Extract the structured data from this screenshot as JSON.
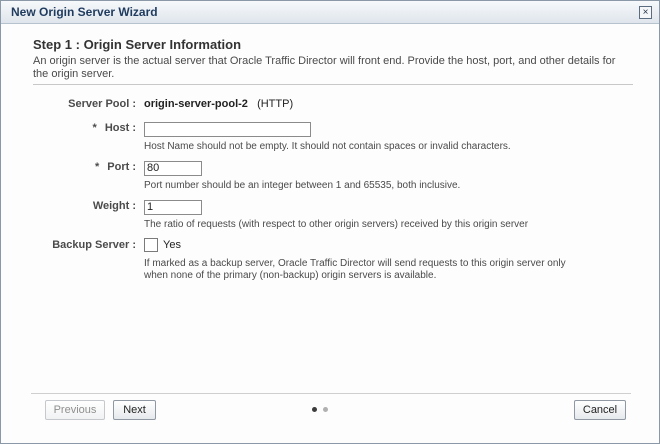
{
  "dialog": {
    "title": "New Origin Server Wizard",
    "close_glyph": "×"
  },
  "step": {
    "title": "Step 1 : Origin Server Information",
    "description": "An origin server is the actual server that Oracle Traffic Director will front end. Provide the host, port, and other details for the origin server."
  },
  "form": {
    "server_pool": {
      "label": "Server Pool :",
      "value": "origin-server-pool-2",
      "protocol": "(HTTP)"
    },
    "host": {
      "required_mark": "*",
      "label": "Host :",
      "value": "",
      "hint": "Host Name should not be empty. It should not contain spaces or invalid characters."
    },
    "port": {
      "required_mark": "*",
      "label": "Port :",
      "value": "80",
      "hint": "Port number should be an integer between 1 and 65535, both inclusive."
    },
    "weight": {
      "label": "Weight :",
      "value": "1",
      "hint": "The ratio of requests (with respect to other origin servers) received by this origin server"
    },
    "backup_server": {
      "label": "Backup Server :",
      "checkbox_label": "Yes",
      "checked": false,
      "hint_line1": "If marked as a backup server, Oracle Traffic Director will send requests to this origin server only",
      "hint_line2": "when none of the primary (non-backup) origin servers is available."
    }
  },
  "buttons": {
    "previous": "Previous",
    "next": "Next",
    "cancel": "Cancel"
  },
  "pagination": {
    "current_step": 1,
    "total_steps": 2
  },
  "colors": {
    "title_text": "#1f3b5e",
    "active_dot": "#3c3c3c",
    "inactive_dot": "#b0b0b0"
  }
}
